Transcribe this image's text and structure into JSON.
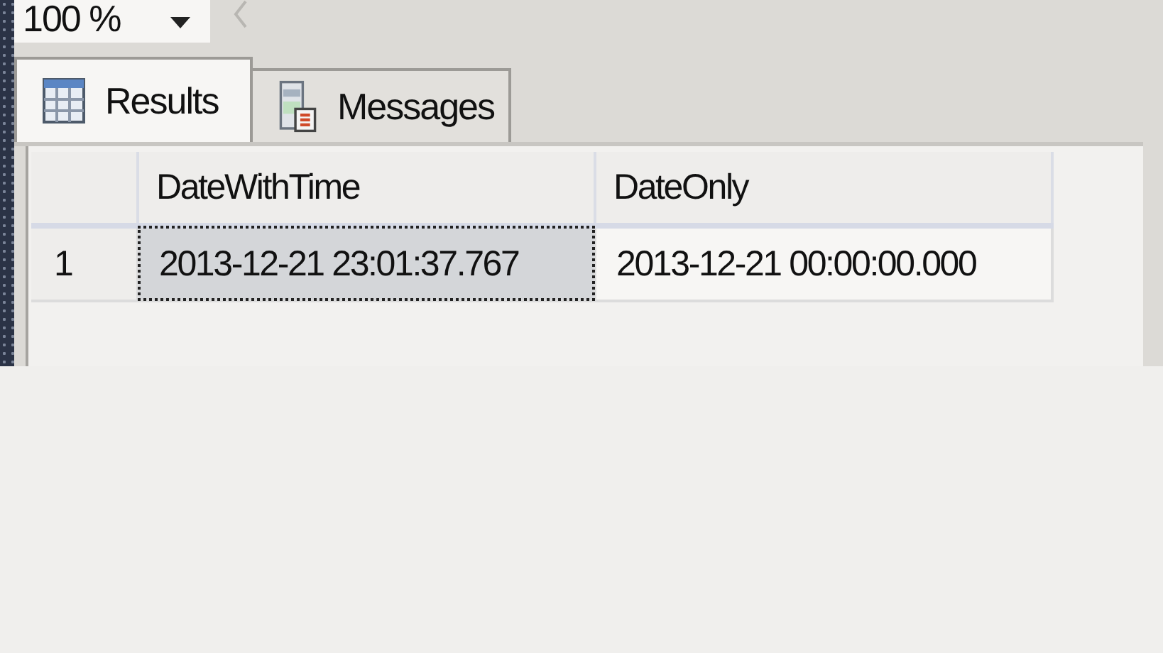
{
  "zoom_combo": {
    "value": "100 %"
  },
  "tabs": [
    {
      "label": "Results",
      "kind": "grid",
      "selected": true
    },
    {
      "label": "Messages",
      "kind": "messages",
      "selected": false
    }
  ],
  "grid": {
    "columns": [
      "DateWithTime",
      "DateOnly"
    ],
    "rows": [
      {
        "number": "1",
        "cells": [
          {
            "text": "2013-12-21 23:01:37.767",
            "selected": true
          },
          {
            "text": "2013-12-21 00:00:00.000",
            "selected": false
          }
        ]
      }
    ]
  }
}
